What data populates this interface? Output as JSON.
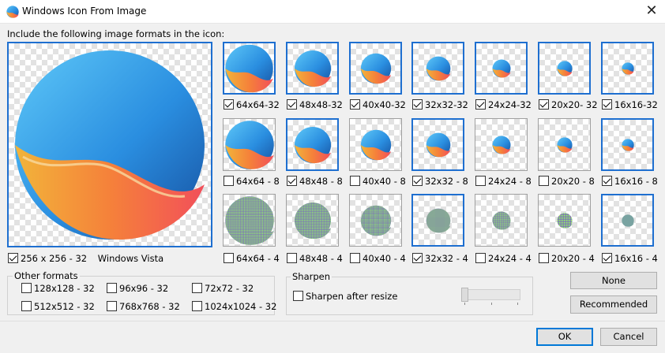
{
  "window": {
    "title": "Windows Icon From Image",
    "close_glyph": "✕"
  },
  "intro": "Include the following image formats in the icon:",
  "big": {
    "label": "256 x 256 - 32",
    "note": "Windows Vista",
    "checked": true
  },
  "grid": [
    [
      {
        "label": "64x64-32",
        "checked": true,
        "selected": true,
        "depth": 32
      },
      {
        "label": "48x48-32",
        "checked": true,
        "selected": true,
        "depth": 32
      },
      {
        "label": "40x40-32",
        "checked": true,
        "selected": true,
        "depth": 32
      },
      {
        "label": "32x32-32",
        "checked": true,
        "selected": true,
        "depth": 32
      },
      {
        "label": "24x24-32",
        "checked": true,
        "selected": true,
        "depth": 32
      },
      {
        "label": "20x20- 32",
        "checked": true,
        "selected": true,
        "depth": 32
      },
      {
        "label": "16x16-32",
        "checked": true,
        "selected": true,
        "depth": 32
      }
    ],
    [
      {
        "label": "64x64 - 8",
        "checked": false,
        "selected": false,
        "depth": 8
      },
      {
        "label": "48x48 - 8",
        "checked": true,
        "selected": true,
        "depth": 8
      },
      {
        "label": "40x40 - 8",
        "checked": false,
        "selected": false,
        "depth": 8
      },
      {
        "label": "32x32 - 8",
        "checked": true,
        "selected": true,
        "depth": 8
      },
      {
        "label": "24x24 - 8",
        "checked": false,
        "selected": false,
        "depth": 8
      },
      {
        "label": "20x20 - 8",
        "checked": false,
        "selected": false,
        "depth": 8
      },
      {
        "label": "16x16 - 8",
        "checked": true,
        "selected": true,
        "depth": 8
      }
    ],
    [
      {
        "label": "64x64 - 4",
        "checked": false,
        "selected": false,
        "depth": 4
      },
      {
        "label": "48x48 - 4",
        "checked": false,
        "selected": false,
        "depth": 4
      },
      {
        "label": "40x40 - 4",
        "checked": false,
        "selected": false,
        "depth": 4
      },
      {
        "label": "32x32 - 4",
        "checked": true,
        "selected": true,
        "depth": 4
      },
      {
        "label": "24x24 - 4",
        "checked": false,
        "selected": false,
        "depth": 4
      },
      {
        "label": "20x20 - 4",
        "checked": false,
        "selected": false,
        "depth": 4
      },
      {
        "label": "16x16 - 4",
        "checked": true,
        "selected": true,
        "depth": 4
      }
    ]
  ],
  "other": {
    "title": "Other formats",
    "items": [
      {
        "label": "128x128 - 32",
        "checked": false
      },
      {
        "label": "96x96 - 32",
        "checked": false
      },
      {
        "label": "72x72 - 32",
        "checked": false
      },
      {
        "label": "512x512 - 32",
        "checked": false
      },
      {
        "label": "768x768 - 32",
        "checked": false
      },
      {
        "label": "1024x1024 - 32",
        "checked": false
      }
    ]
  },
  "sharpen": {
    "title": "Sharpen",
    "checkbox_label": "Sharpen after resize",
    "checked": false,
    "level": 0
  },
  "buttons": {
    "none": "None",
    "recommended": "Recommended",
    "ok": "OK",
    "cancel": "Cancel"
  },
  "colors": {
    "accent": "#1e6fd0",
    "blue_top": "#3fb4f0",
    "blue_dark": "#1a5fb4",
    "orange": "#f0a830",
    "red": "#f05050"
  }
}
